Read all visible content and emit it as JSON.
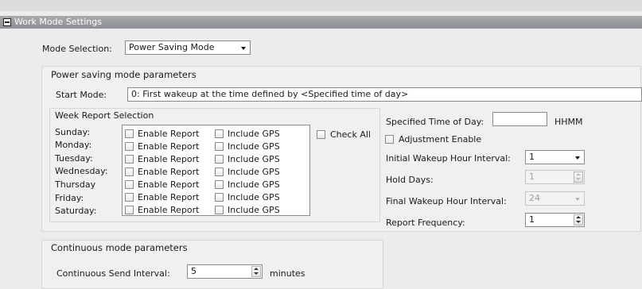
{
  "header": {
    "title": "Work Mode Settings"
  },
  "mode": {
    "label": "Mode Selection:",
    "value": "Power Saving Mode"
  },
  "power_saving": {
    "legend": "Power saving mode parameters",
    "start_mode_label": "Start Mode:",
    "start_mode_value": "0: First wakeup at the time defined by <Specified time of day>"
  },
  "week_report": {
    "legend": "Week Report Selection",
    "days": [
      "Sunday:",
      "Monday:",
      "Tuesday:",
      "Wednesday:",
      "Thursday",
      "Friday:",
      "Saturday:"
    ],
    "enable_label": "Enable Report",
    "gps_label": "Include GPS",
    "check_all_label": "Check All"
  },
  "right_panel": {
    "time_of_day_label": "Specified Time of Day:",
    "time_of_day_value": "",
    "time_unit": "HHMM",
    "adjustment_label": "Adjustment Enable",
    "initial_interval_label": "Initial Wakeup Hour Interval:",
    "initial_interval_value": "1",
    "hold_days_label": "Hold Days:",
    "hold_days_value": "1",
    "final_interval_label": "Final Wakeup Hour Interval:",
    "final_interval_value": "24",
    "report_freq_label": "Report Frequency:",
    "report_freq_value": "1"
  },
  "continuous": {
    "legend": "Continuous mode parameters",
    "send_interval_label": "Continuous Send Interval:",
    "send_interval_value": "5",
    "unit": "minutes"
  },
  "colors": {
    "header_bg": "#9a9c9f",
    "panel_bg": "#ececec",
    "group_bg": "#f0f0f0",
    "field_border": "#8a8a8a"
  },
  "icons": {
    "collapse": "minus-box-icon",
    "dropdown": "chevron-down-icon",
    "spinner": "spin-arrows-icon"
  }
}
